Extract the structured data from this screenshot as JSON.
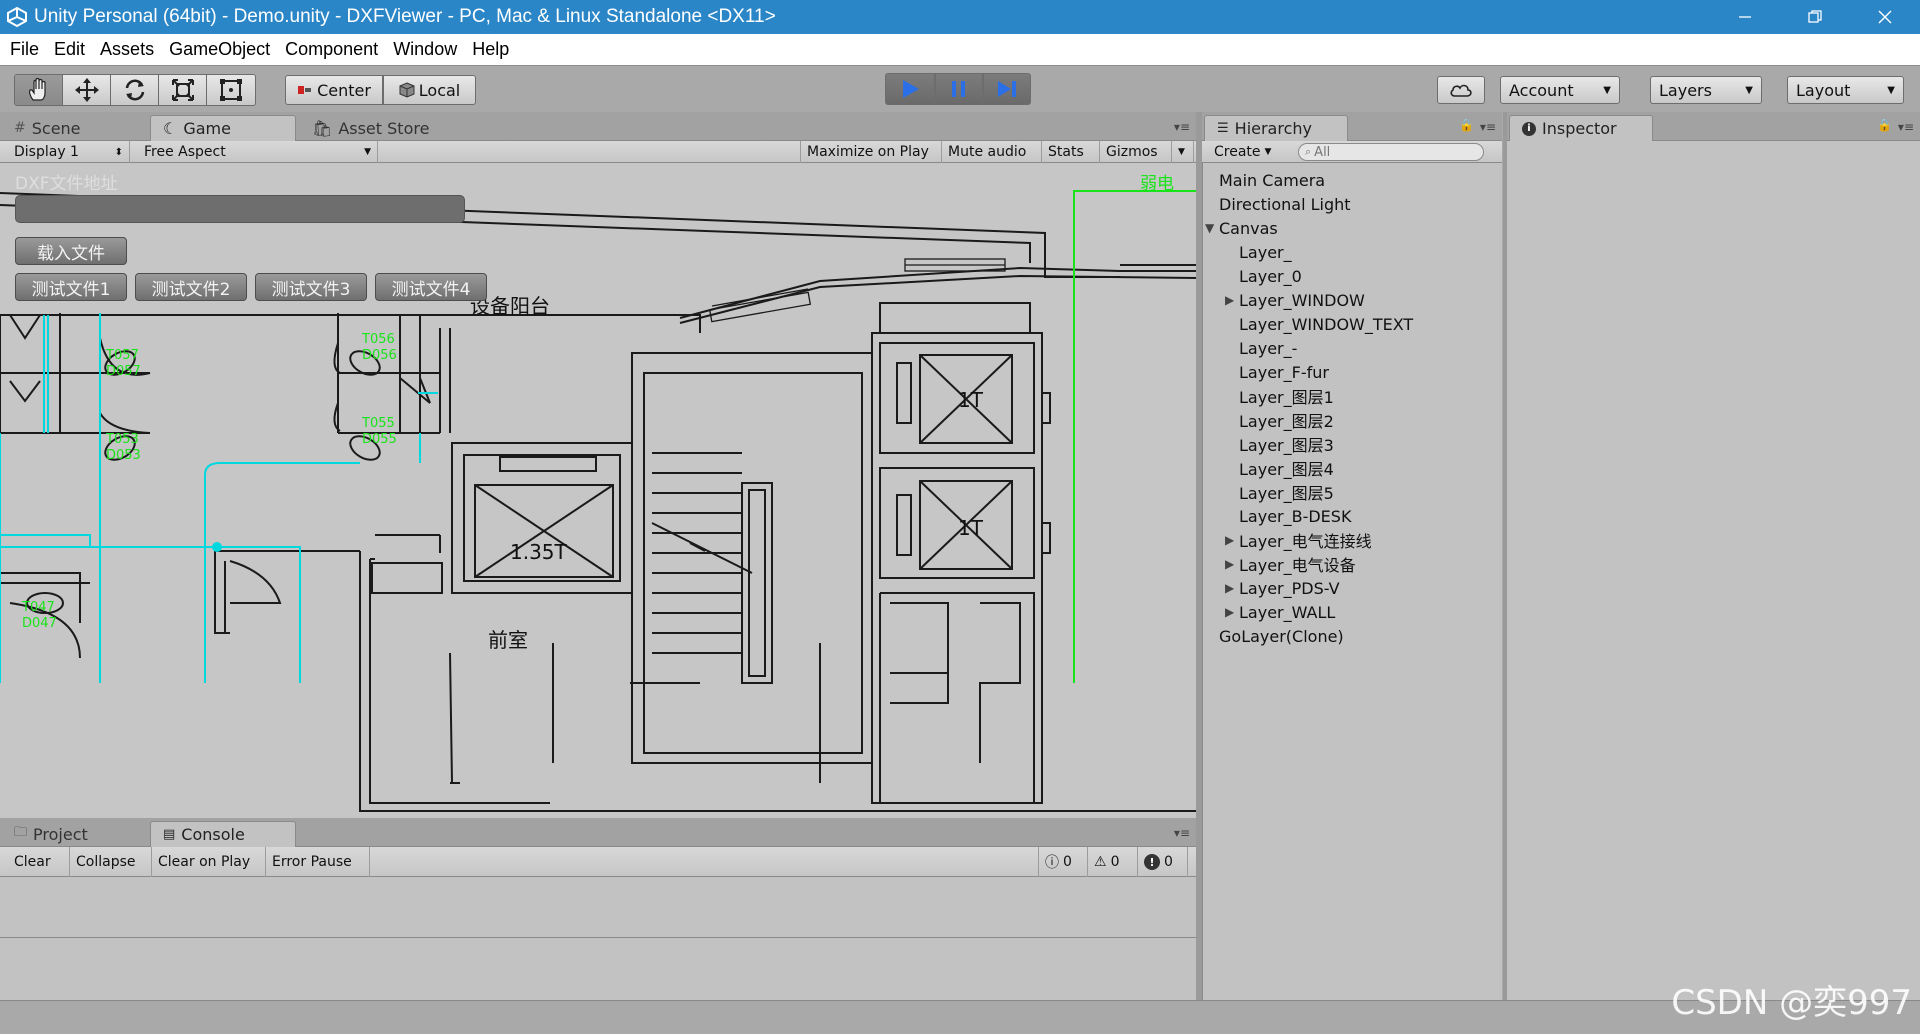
{
  "window": {
    "title": "Unity Personal (64bit) - Demo.unity - DXFViewer - PC, Mac & Linux Standalone <DX11>",
    "controls": [
      "minimize-icon",
      "restore-icon",
      "close-icon"
    ]
  },
  "menu": [
    "File",
    "Edit",
    "Assets",
    "GameObject",
    "Component",
    "Window",
    "Help"
  ],
  "toolbar": {
    "tools": [
      "hand-icon",
      "move-icon",
      "rotate-icon",
      "scale-icon",
      "rect-tool-icon"
    ],
    "pivot_label": "Center",
    "space_label": "Local",
    "play_controls": [
      "play-icon",
      "pause-icon",
      "step-icon"
    ],
    "account_label": "Account",
    "layers_label": "Layers",
    "layout_label": "Layout"
  },
  "scene_panel": {
    "tabs": [
      "Scene",
      "Game",
      "Asset Store"
    ],
    "active_tab": "Game",
    "display_label": "Display 1",
    "aspect_label": "Free Aspect",
    "buttons": [
      "Maximize on Play",
      "Mute audio",
      "Stats",
      "Gizmos"
    ]
  },
  "game_ui": {
    "label": "DXF文件地址",
    "load_button": "载入文件",
    "test_buttons": [
      "测试文件1",
      "测试文件2",
      "测试文件3",
      "测试文件4"
    ]
  },
  "drawing_text": {
    "balcony": "设备阳台",
    "elevator_load": "1.35T",
    "front_room": "前室",
    "lift_1t_a": "1T",
    "lift_1t_b": "1T",
    "weak_current": "弱电",
    "desk_labels": [
      "T057",
      "D057",
      "T053",
      "D053",
      "T056",
      "D056",
      "T055",
      "D055",
      "T047",
      "D047"
    ]
  },
  "hierarchy": {
    "tab": "Hierarchy",
    "create_label": "Create",
    "search_placeholder": "All",
    "items": [
      {
        "label": "Main Camera",
        "indent": 0,
        "expander": ""
      },
      {
        "label": "Directional Light",
        "indent": 0,
        "expander": ""
      },
      {
        "label": "Canvas",
        "indent": 0,
        "expander": "▼"
      },
      {
        "label": "Layer_",
        "indent": 1,
        "expander": ""
      },
      {
        "label": "Layer_0",
        "indent": 1,
        "expander": ""
      },
      {
        "label": "Layer_WINDOW",
        "indent": 1,
        "expander": "▶"
      },
      {
        "label": "Layer_WINDOW_TEXT",
        "indent": 1,
        "expander": ""
      },
      {
        "label": "Layer_-",
        "indent": 1,
        "expander": ""
      },
      {
        "label": "Layer_F-fur",
        "indent": 1,
        "expander": ""
      },
      {
        "label": "Layer_图层1",
        "indent": 1,
        "expander": ""
      },
      {
        "label": "Layer_图层2",
        "indent": 1,
        "expander": ""
      },
      {
        "label": "Layer_图层3",
        "indent": 1,
        "expander": ""
      },
      {
        "label": "Layer_图层4",
        "indent": 1,
        "expander": ""
      },
      {
        "label": "Layer_图层5",
        "indent": 1,
        "expander": ""
      },
      {
        "label": "Layer_B-DESK",
        "indent": 1,
        "expander": ""
      },
      {
        "label": "Layer_电气连接线",
        "indent": 1,
        "expander": "▶"
      },
      {
        "label": "Layer_电气设备",
        "indent": 1,
        "expander": "▶"
      },
      {
        "label": "Layer_PDS-V",
        "indent": 1,
        "expander": "▶"
      },
      {
        "label": "Layer_WALL",
        "indent": 1,
        "expander": "▶"
      },
      {
        "label": "GoLayer(Clone)",
        "indent": 0,
        "expander": ""
      }
    ]
  },
  "inspector": {
    "tab": "Inspector"
  },
  "bottom_panel": {
    "tabs": [
      "Project",
      "Console"
    ],
    "active_tab": "Console",
    "buttons": [
      "Clear",
      "Collapse",
      "Clear on Play",
      "Error Pause"
    ],
    "counts": {
      "info": "0",
      "warning": "0",
      "error": "0"
    }
  },
  "watermark": "CSDN @奕997",
  "colors": {
    "title_bar": "#2b86c8",
    "cad_green": "#19e419",
    "cad_cyan": "#00d8e0",
    "play_blue": "#2b6fe6"
  }
}
